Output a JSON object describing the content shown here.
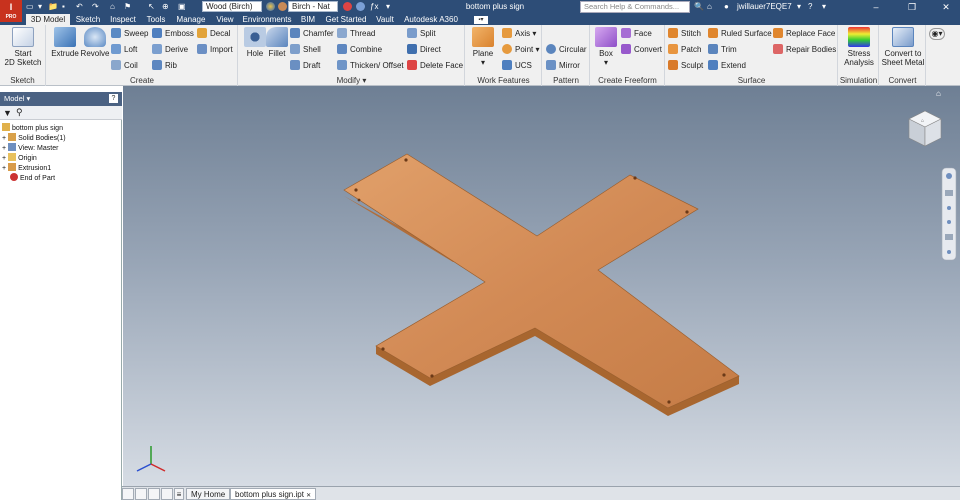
{
  "app": {
    "logo": "I",
    "logo_sub": "PRO"
  },
  "quick_access": {
    "material": "Wood (Birch)",
    "appearance": "Birch - Nat"
  },
  "document_title": "bottom plus sign",
  "search_placeholder": "Search Help & Commands...",
  "user": "jwillauer7EQE7",
  "tabs": [
    "3D Model",
    "Sketch",
    "Inspect",
    "Tools",
    "Manage",
    "View",
    "Environments",
    "BIM",
    "Get Started",
    "Vault",
    "Autodesk A360"
  ],
  "ribbon": {
    "sketch": {
      "title": "Sketch",
      "start": "Start",
      "start2": "2D Sketch"
    },
    "create": {
      "title": "Create",
      "extrude": "Extrude",
      "revolve": "Revolve",
      "sweep": "Sweep",
      "emboss": "Emboss",
      "decal": "Decal",
      "loft": "Loft",
      "derive": "Derive",
      "import": "Import",
      "coil": "Coil",
      "rib": "Rib"
    },
    "modify": {
      "title": "Modify",
      "hole": "Hole",
      "fillet": "Fillet",
      "chamfer": "Chamfer",
      "thread": "Thread",
      "split": "Split",
      "shell": "Shell",
      "combine": "Combine",
      "direct": "Direct",
      "draft": "Draft",
      "thicken": "Thicken/ Offset",
      "delete_face": "Delete Face"
    },
    "work_features": {
      "title": "Work Features",
      "plane": "Plane",
      "axis": "Axis",
      "point": "Point",
      "ucs": "UCS"
    },
    "pattern": {
      "title": "Pattern",
      "circular": "Circular",
      "mirror": "Mirror"
    },
    "freeform": {
      "title": "Create Freeform",
      "box": "Box",
      "face": "Face",
      "convert": "Convert"
    },
    "surface": {
      "title": "Surface",
      "stitch": "Stitch",
      "ruled_surface": "Ruled Surface",
      "replace_face": "Replace Face",
      "patch": "Patch",
      "trim": "Trim",
      "repair_bodies": "Repair Bodies",
      "sculpt": "Sculpt",
      "extend": "Extend"
    },
    "simulation": {
      "title": "Simulation",
      "stress": "Stress",
      "analysis": "Analysis"
    },
    "convert": {
      "title": "Convert",
      "convert_to": "Convert to",
      "sheet_metal": "Sheet Metal"
    }
  },
  "browser": {
    "title": "Model",
    "items": [
      "bottom plus sign",
      "Solid Bodies(1)",
      "View: Master",
      "Origin",
      "Extrusion1",
      "End of Part"
    ]
  },
  "status_tabs": [
    "My Home",
    "bottom plus sign.ipt"
  ],
  "colors": {
    "accent": "#2d4d77",
    "wood": "#d48d5a",
    "wood_edge": "#b5713f",
    "viewport_top": "#6e7f94"
  }
}
